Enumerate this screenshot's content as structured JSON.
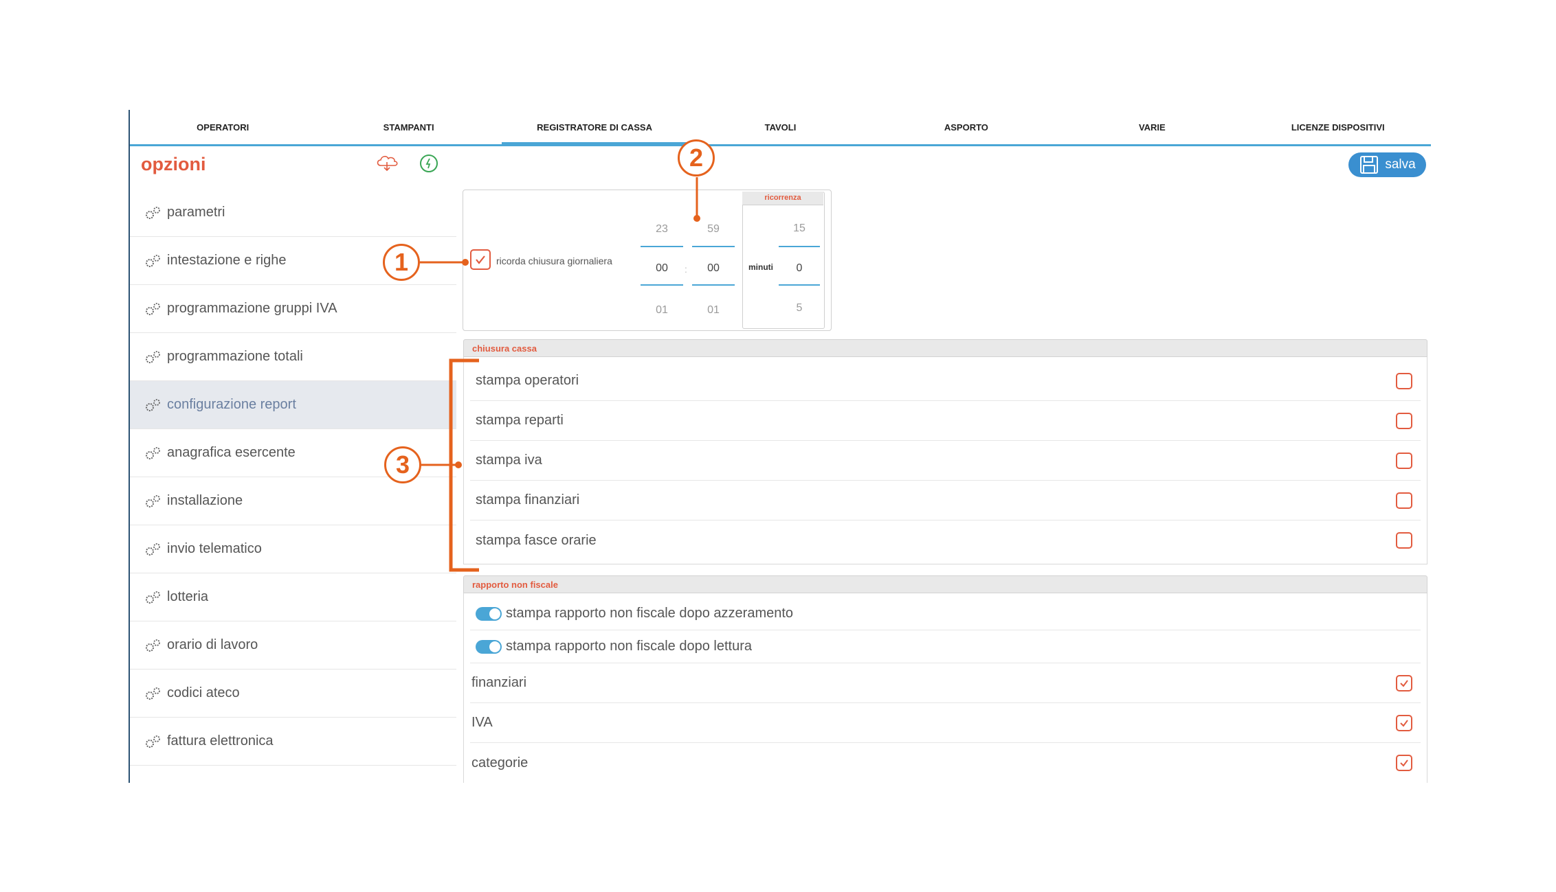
{
  "tabs": [
    {
      "label": "OPERATORI"
    },
    {
      "label": "STAMPANTI"
    },
    {
      "label": "REGISTRATORE DI CASSA"
    },
    {
      "label": "TAVOLI"
    },
    {
      "label": "ASPORTO"
    },
    {
      "label": "VARIE"
    },
    {
      "label": "LICENZE DISPOSITIVI"
    }
  ],
  "active_tab": "REGISTRATORE DI CASSA",
  "header": {
    "title": "opzioni",
    "save_label": "salva"
  },
  "sidebar": {
    "selected": "configurazione report",
    "items": [
      {
        "label": "parametri"
      },
      {
        "label": "intestazione e righe"
      },
      {
        "label": "programmazione gruppi IVA"
      },
      {
        "label": "programmazione totali"
      },
      {
        "label": "configurazione report"
      },
      {
        "label": "anagrafica esercente"
      },
      {
        "label": "installazione"
      },
      {
        "label": "invio telematico"
      },
      {
        "label": "lotteria"
      },
      {
        "label": "orario di lavoro"
      },
      {
        "label": "codici ateco"
      },
      {
        "label": "fattura elettronica"
      }
    ]
  },
  "daily_close": {
    "checkbox_label": "ricorda chiusura giornaliera",
    "checked": true,
    "hours": {
      "prev": "23",
      "value": "00",
      "next": "01"
    },
    "minutes": {
      "prev": "59",
      "value": "00",
      "next": "01"
    },
    "separator": ":",
    "recurrence": {
      "title": "ricorrenza",
      "unit_label": "minuti",
      "prev": "15",
      "value": "0",
      "next": "5"
    }
  },
  "chiusura_cassa": {
    "title": "chiusura cassa",
    "rows": [
      {
        "label": "stampa operatori",
        "checked": false
      },
      {
        "label": "stampa reparti",
        "checked": false
      },
      {
        "label": "stampa iva",
        "checked": false
      },
      {
        "label": "stampa finanziari",
        "checked": false
      },
      {
        "label": "stampa fasce orarie",
        "checked": false
      }
    ]
  },
  "rapporto_non_fiscale": {
    "title": "rapporto non fiscale",
    "toggles": [
      {
        "label": "stampa rapporto non fiscale dopo azzeramento",
        "on": true
      },
      {
        "label": "stampa rapporto non fiscale dopo lettura",
        "on": true
      }
    ],
    "rows": [
      {
        "label": "finanziari",
        "checked": true
      },
      {
        "label": "IVA",
        "checked": true
      },
      {
        "label": "categorie",
        "checked": true
      }
    ]
  },
  "annotations": [
    "1",
    "2",
    "3"
  ],
  "colors": {
    "accent": "#e25b3f",
    "blue": "#4aa6d6",
    "annotation": "#e5621d",
    "save_button": "#3a8fd0"
  }
}
